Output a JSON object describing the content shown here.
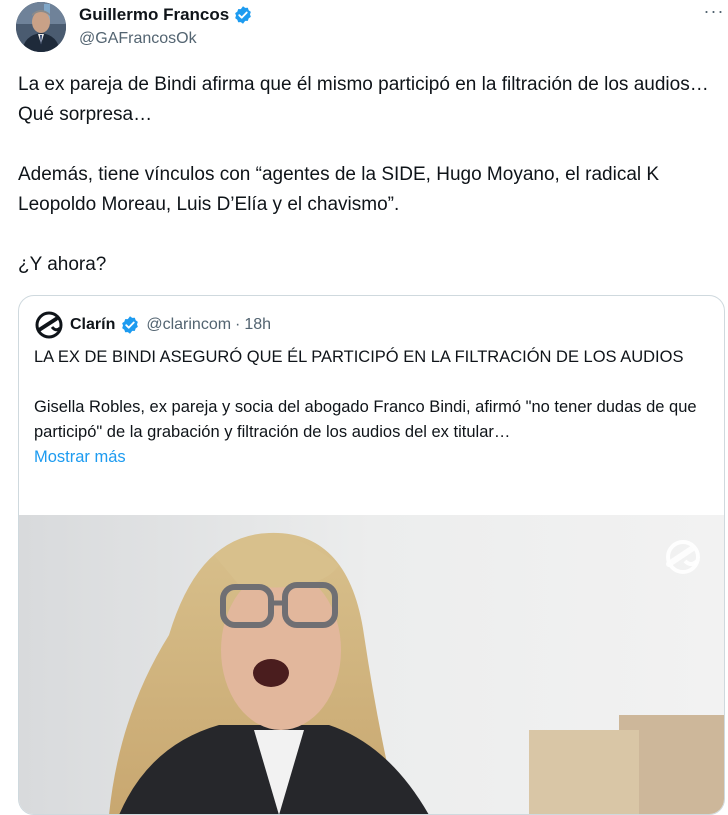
{
  "author": {
    "display_name": "Guillermo Francos",
    "handle": "@GAFrancosOk",
    "verified": true
  },
  "more_icon": "···",
  "tweet": {
    "text": "La ex pareja de Bindi afirma que él mismo participó en la filtración de los audios… Qué sorpresa…\n\nAdemás, tiene vínculos con “agentes de la SIDE, Hugo Moyano, el radical K Leopoldo Moreau, Luis D’Elía y el chavismo”.\n\n¿Y ahora?"
  },
  "quoted": {
    "display_name": "Clarín",
    "handle": "@clarincom",
    "separator": "·",
    "time": "18h",
    "text": "LA EX DE BINDI ASEGURÓ QUE ÉL PARTICIPÓ EN LA FILTRACIÓN DE LOS AUDIOS\n\nGisella Robles, ex pareja y socia del abogado Franco Bindi, afirmó \"no tener dudas de que participó\" de la grabación y filtración de los audios del ex titular…",
    "show_more": "Mostrar más"
  },
  "colors": {
    "text_primary": "#0f1419",
    "text_secondary": "#536471",
    "link": "#1d9bf0",
    "verified_badge": "#1d9bf0",
    "border": "#cfd9de"
  }
}
